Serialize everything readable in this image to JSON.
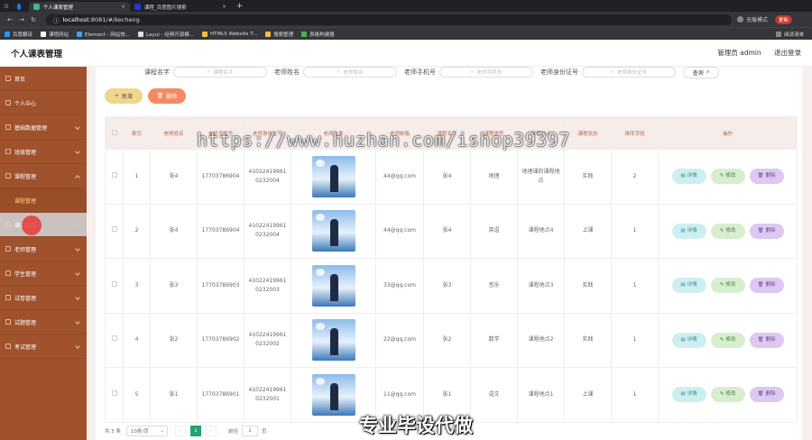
{
  "browser": {
    "tabs": [
      {
        "label": "个人课表管理",
        "active": true
      },
      {
        "label": "课程_百度图片搜索",
        "active": false
      }
    ],
    "url_host": "localhost",
    "url_path": ":8081/#/kecheng",
    "guest_label": "无痕模式",
    "badge": "更新",
    "bookmarks": [
      "百度翻译",
      "课程网站",
      "Element - 网站快...",
      "Layui - 经典开源模...",
      "HTML5 Website T...",
      "搜索整理",
      "表格构建器"
    ],
    "reading_list": "阅读清单"
  },
  "app": {
    "title": "个人课表管理",
    "user": "管理员 admin",
    "logout": "退出登录"
  },
  "sidebar": [
    {
      "label": "首页"
    },
    {
      "label": "个人中心"
    },
    {
      "label": "基础数据管理"
    },
    {
      "label": "班级管理"
    },
    {
      "label": "课程管理",
      "open": true,
      "children": [
        "课程管理"
      ]
    },
    {
      "label": "课表管理",
      "highlight": true
    },
    {
      "label": "老师管理"
    },
    {
      "label": "学生管理"
    },
    {
      "label": "试卷管理"
    },
    {
      "label": "试题管理"
    },
    {
      "label": "考试管理"
    }
  ],
  "search": {
    "fields": [
      {
        "label": "课程名字",
        "placeholder": "课程名字"
      },
      {
        "label": "老师姓名",
        "placeholder": "老师姓名"
      },
      {
        "label": "老师手机号",
        "placeholder": "老师手机号"
      },
      {
        "label": "老师身份证号",
        "placeholder": "老师身份证号"
      }
    ],
    "button": "查询"
  },
  "actions": {
    "add": "新增",
    "delete": "删除"
  },
  "table": {
    "headers": [
      "索引",
      "老师姓名",
      "老师手机号",
      "老师身份证号",
      "老师头像",
      "老师邮箱",
      "课程名字",
      "课程类型",
      "课程地点",
      "课程状态",
      "排序字段",
      "操作"
    ],
    "rows": [
      {
        "index": "1",
        "name": "张4",
        "phone": "17703786904",
        "id": "410224199610232004",
        "email": "44@qq.com",
        "course": "张4",
        "type": "地理",
        "place": "地理课的课程地点",
        "status": "实践",
        "sort": "2"
      },
      {
        "index": "2",
        "name": "张4",
        "phone": "17703786904",
        "id": "410224199610232004",
        "email": "44@qq.com",
        "course": "张4",
        "type": "英语",
        "place": "课程地点4",
        "status": "上课",
        "sort": "1"
      },
      {
        "index": "3",
        "name": "张3",
        "phone": "17703786903",
        "id": "410224199610232003",
        "email": "33@qq.com",
        "course": "张3",
        "type": "音乐",
        "place": "课程地点3",
        "status": "实践",
        "sort": "1"
      },
      {
        "index": "4",
        "name": "张2",
        "phone": "17703786902",
        "id": "410224199610232002",
        "email": "22@qq.com",
        "course": "张2",
        "type": "数学",
        "place": "课程地点2",
        "status": "实践",
        "sort": "1"
      },
      {
        "index": "5",
        "name": "张1",
        "phone": "17703786901",
        "id": "410224199610232001",
        "email": "11@qq.com",
        "course": "张1",
        "type": "语文",
        "place": "课程地点1",
        "status": "上课",
        "sort": "1"
      }
    ],
    "ops": {
      "detail": "详情",
      "edit": "修改",
      "delete": "删除"
    }
  },
  "pagination": {
    "total": "共 5 条",
    "page_size": "10条/页",
    "current": "1",
    "goto": "前往",
    "page": "页",
    "goto_value": "1"
  },
  "overlay": {
    "watermark": "https://www.huzhan.com/ishop39397",
    "caption": "专业毕设代做"
  }
}
